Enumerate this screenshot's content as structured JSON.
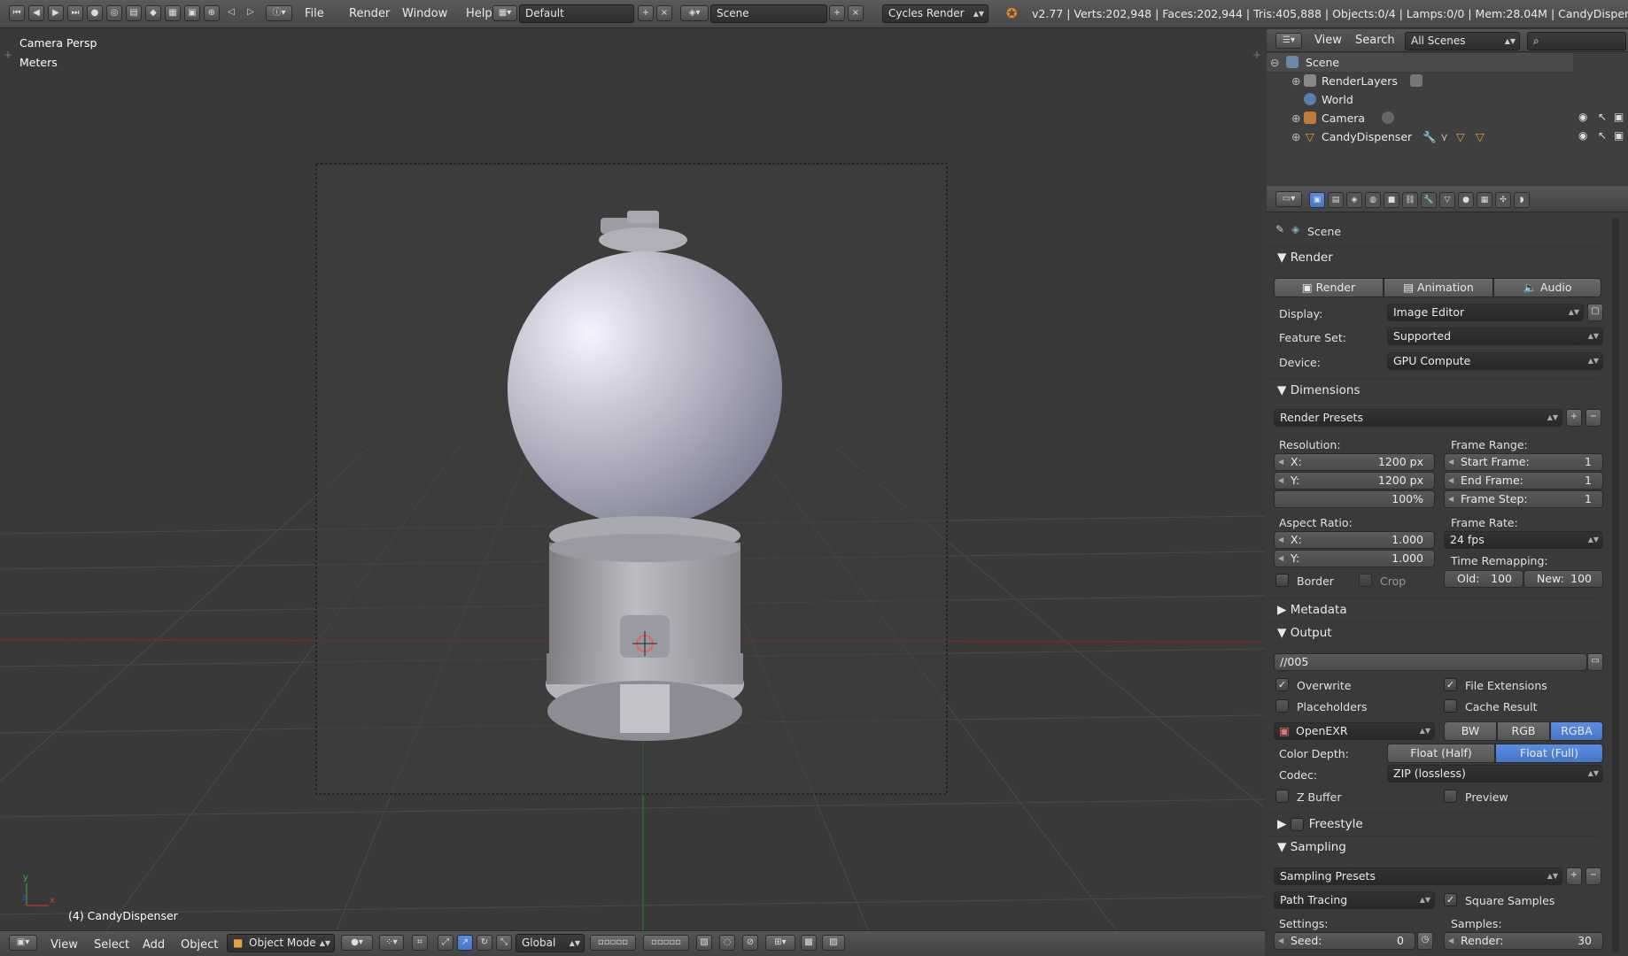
{
  "topbar": {
    "menus": [
      "File",
      "Render",
      "Window",
      "Help"
    ],
    "layout": "Default",
    "scene": "Scene",
    "engine": "Cycles Render",
    "stats": "v2.77 | Verts:202,948 | Faces:202,944 | Tris:405,888 | Objects:0/4 | Lamps:0/0 | Mem:28.04M | CandyDispenser"
  },
  "viewport": {
    "view_name": "Camera Persp",
    "units": "Meters",
    "active_object": "(4) CandyDispenser"
  },
  "bottombar": {
    "menus": [
      "View",
      "Select",
      "Add",
      "Object"
    ],
    "mode": "Object Mode",
    "orientation": "Global"
  },
  "outliner": {
    "menus": [
      "View",
      "Search"
    ],
    "filter": "All Scenes",
    "items": [
      "Scene",
      "RenderLayers",
      "World",
      "Camera",
      "CandyDispenser"
    ]
  },
  "props": {
    "context": "Scene",
    "render": {
      "title": "Render",
      "buttons": [
        "Render",
        "Animation",
        "Audio"
      ],
      "display_label": "Display:",
      "display": "Image Editor",
      "feature_label": "Feature Set:",
      "feature": "Supported",
      "device_label": "Device:",
      "device": "GPU Compute"
    },
    "dimensions": {
      "title": "Dimensions",
      "presets": "Render Presets",
      "resolution_label": "Resolution:",
      "res_x_label": "X:",
      "res_x": "1200 px",
      "res_y_label": "Y:",
      "res_y": "1200 px",
      "res_pct": "100%",
      "frame_range_label": "Frame Range:",
      "start_label": "Start Frame:",
      "start": "1",
      "end_label": "End Frame:",
      "end": "1",
      "step_label": "Frame Step:",
      "step": "1",
      "aspect_label": "Aspect Ratio:",
      "asp_x_label": "X:",
      "asp_x": "1.000",
      "asp_y_label": "Y:",
      "asp_y": "1.000",
      "framerate_label": "Frame Rate:",
      "framerate": "24 fps",
      "remap_label": "Time Remapping:",
      "old_label": "Old:",
      "old": "100",
      "new_label": "New:",
      "new": "100",
      "border": "Border",
      "crop": "Crop"
    },
    "metadata": {
      "title": "Metadata"
    },
    "output": {
      "title": "Output",
      "path": "//005",
      "overwrite": "Overwrite",
      "file_ext": "File Extensions",
      "placeholders": "Placeholders",
      "cache": "Cache Result",
      "format": "OpenEXR",
      "channels": [
        "BW",
        "RGB",
        "RGBA"
      ],
      "depth_label": "Color Depth:",
      "depths": [
        "Float (Half)",
        "Float (Full)"
      ],
      "codec_label": "Codec:",
      "codec": "ZIP (lossless)",
      "zbuffer": "Z Buffer",
      "preview": "Preview"
    },
    "freestyle": {
      "title": "Freestyle"
    },
    "sampling": {
      "title": "Sampling",
      "presets": "Sampling Presets",
      "integrator": "Path Tracing",
      "square": "Square Samples",
      "settings_label": "Settings:",
      "samples_label": "Samples:",
      "seed_label": "Seed:",
      "seed": "0",
      "render_label": "Render:",
      "render": "30"
    }
  }
}
